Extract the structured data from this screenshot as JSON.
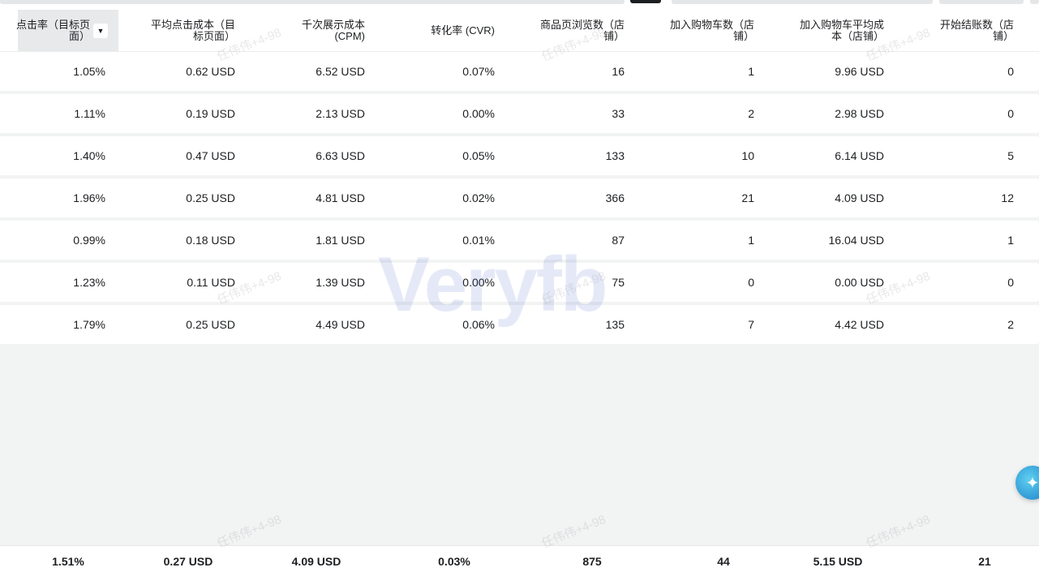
{
  "columns": [
    {
      "key": "ctr_dest",
      "label": "点击率（目标页\n面）"
    },
    {
      "key": "cpc_dest",
      "label": "平均点击成本（目\n标页面）"
    },
    {
      "key": "cpm",
      "label": "千次展示成本\n(CPM)"
    },
    {
      "key": "cvr",
      "label": "转化率 (CVR)"
    },
    {
      "key": "pdp_views",
      "label": "商品页浏览数（店\n铺）"
    },
    {
      "key": "add_to_cart",
      "label": "加入购物车数（店\n铺）"
    },
    {
      "key": "add_to_cart_cost",
      "label": "加入购物车平均成\n本（店铺）"
    },
    {
      "key": "checkout",
      "label": "开始结账数（店\n铺）"
    }
  ],
  "rows": [
    [
      "1.05%",
      "0.62 USD",
      "6.52 USD",
      "0.07%",
      "16",
      "1",
      "9.96 USD",
      "0"
    ],
    [
      "1.11%",
      "0.19 USD",
      "2.13 USD",
      "0.00%",
      "33",
      "2",
      "2.98 USD",
      "0"
    ],
    [
      "1.40%",
      "0.47 USD",
      "6.63 USD",
      "0.05%",
      "133",
      "10",
      "6.14 USD",
      "5"
    ],
    [
      "1.96%",
      "0.25 USD",
      "4.81 USD",
      "0.02%",
      "366",
      "21",
      "4.09 USD",
      "12"
    ],
    [
      "0.99%",
      "0.18 USD",
      "1.81 USD",
      "0.01%",
      "87",
      "1",
      "16.04 USD",
      "1"
    ],
    [
      "1.23%",
      "0.11 USD",
      "1.39 USD",
      "0.00%",
      "75",
      "0",
      "0.00 USD",
      "0"
    ],
    [
      "1.79%",
      "0.25 USD",
      "4.49 USD",
      "0.06%",
      "135",
      "7",
      "4.42 USD",
      "2"
    ]
  ],
  "totals": [
    "1.51%",
    "0.27 USD",
    "4.09 USD",
    "0.03%",
    "875",
    "44",
    "5.15 USD",
    "21"
  ],
  "watermark_text": "任伟伟+4-98",
  "brand_watermark": "Veryfb",
  "icons": {
    "sort": "caret-down-icon",
    "assistant": "star-assistant-icon"
  },
  "colors": {
    "background": "#f2f3f3",
    "row": "#ffffff",
    "selected_header": "#e8e9ea",
    "text": "#1c1e21"
  }
}
